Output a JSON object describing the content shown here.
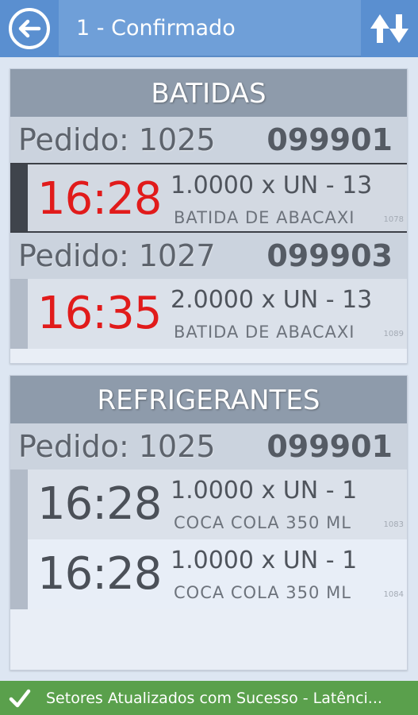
{
  "header": {
    "title": "1 - Confirmado",
    "back_icon": "back-arrow-icon",
    "refresh_icon": "refresh-arrows-icon"
  },
  "sections": [
    {
      "title": "BATIDAS",
      "orders": [
        {
          "label": "Pedido: 1025",
          "code": "099901",
          "items": [
            {
              "time": "16:28",
              "qty": "1.0000 x UN   - 13",
              "name": "BATIDA DE ABACAXI",
              "id": "1078",
              "selected": true
            }
          ]
        },
        {
          "label": "Pedido: 1027",
          "code": "099903",
          "items": [
            {
              "time": "16:35",
              "qty": "2.0000 x UN   - 13",
              "name": "BATIDA DE ABACAXI",
              "id": "1089",
              "selected": false
            }
          ]
        }
      ]
    },
    {
      "title": "REFRIGERANTES",
      "orders": [
        {
          "label": "Pedido: 1025",
          "code": "099901",
          "items": [
            {
              "time": "16:28",
              "qty": "1.0000 x UN   - 1",
              "name": "COCA COLA 350 ML",
              "id": "1083",
              "selected": false
            },
            {
              "time": "16:28",
              "qty": "1.0000 x UN   - 1",
              "name": "COCA COLA 350 ML",
              "id": "1084",
              "selected": false
            }
          ]
        }
      ]
    }
  ],
  "status": {
    "text": "Setores Atualizados com Sucesso - Latênci...",
    "icon": "check-icon"
  },
  "colors": {
    "header_bg": "#6f9fd8",
    "late_time": "#e11b1b",
    "normal_time": "#4b5058",
    "status_bg": "#5aa04c"
  }
}
